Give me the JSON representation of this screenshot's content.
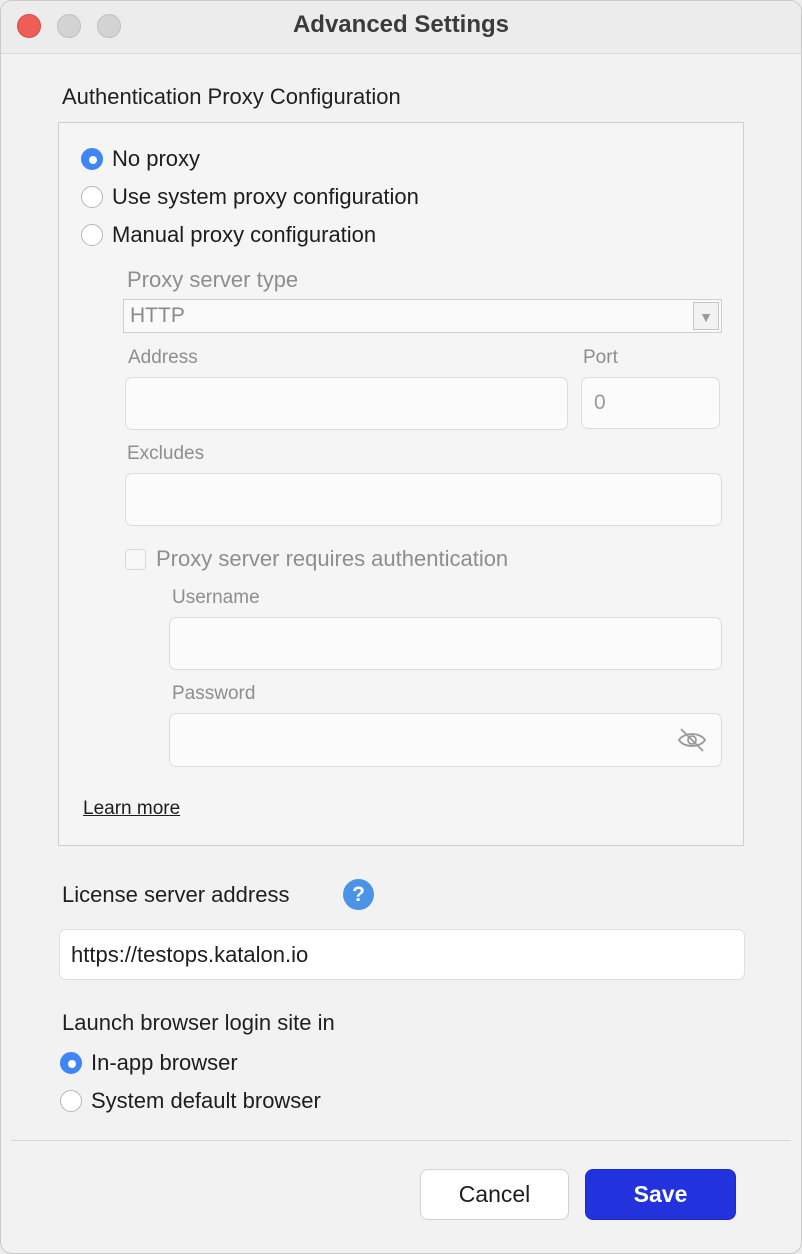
{
  "window": {
    "title": "Advanced Settings"
  },
  "proxy": {
    "section_label": "Authentication Proxy Configuration",
    "options": [
      {
        "label": "No proxy",
        "selected": true
      },
      {
        "label": "Use system proxy configuration",
        "selected": false
      },
      {
        "label": "Manual proxy configuration",
        "selected": false
      }
    ],
    "server_type_label": "Proxy server type",
    "server_type_value": "HTTP",
    "address_label": "Address",
    "address_value": "",
    "port_label": "Port",
    "port_value": "0",
    "excludes_label": "Excludes",
    "excludes_value": "",
    "auth_checkbox_label": "Proxy server requires authentication",
    "auth_checked": false,
    "username_label": "Username",
    "username_value": "",
    "password_label": "Password",
    "password_value": "",
    "password_toggle_icon": "eye-slash-icon",
    "learn_more": "Learn more"
  },
  "license": {
    "label": "License server address",
    "help_icon": "question-circle-icon",
    "value": "https://testops.katalon.io"
  },
  "browser": {
    "label": "Launch browser login site in",
    "options": [
      {
        "label": "In-app browser",
        "selected": true
      },
      {
        "label": "System default browser",
        "selected": false
      }
    ]
  },
  "footer": {
    "cancel": "Cancel",
    "save": "Save"
  },
  "colors": {
    "accent": "#3e86f5",
    "primary_button": "#2233dd",
    "help_icon": "#4a93e6",
    "close": "#ee5e57"
  }
}
